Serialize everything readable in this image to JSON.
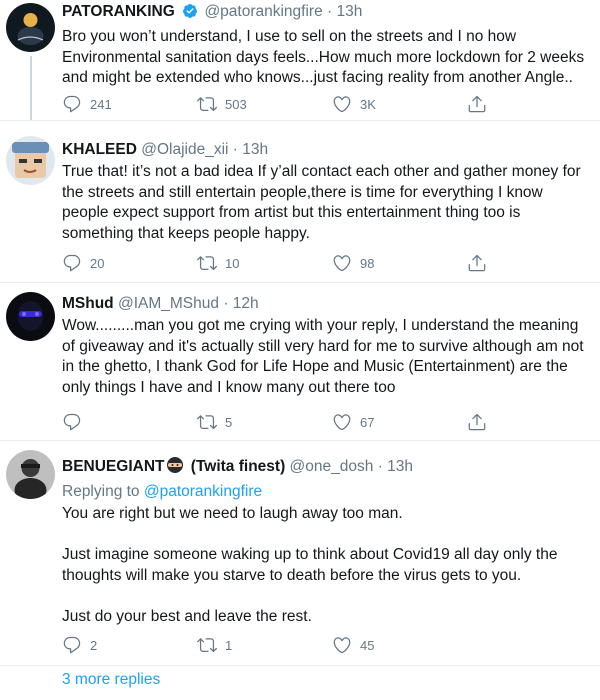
{
  "tweets": [
    {
      "name": "PATORANKING",
      "handle": "@patorankingfire",
      "time": "13h",
      "text": "Bro you won’t understand, I use to sell on the streets and I no how Environmental sanitation days feels...How much more lockdown for 2 weeks and might be extended who knows...just facing reality from another Angle..",
      "replies": "241",
      "retweets": "503",
      "likes": "3K",
      "verified": true
    },
    {
      "name": "KHALEED",
      "handle": "@Olajide_xii",
      "time": "13h",
      "text": "True that! it’s not a bad idea If y’all contact each other and gather money for the streets and still entertain people,there is time for everything I know people expect support from artist but this entertainment thing too is something that keeps people happy.",
      "replies": "20",
      "retweets": "10",
      "likes": "98"
    },
    {
      "name": "MShud",
      "handle": "@IAM_MShud",
      "time": "12h",
      "text": "Wow.........man you got me crying with your reply, I understand the meaning of giveaway and it's actually still very hard for me to survive although am not in the ghetto, I thank God for Life Hope and Music (Entertainment) are the only things I have and I know many out there too",
      "replies": "",
      "retweets": "5",
      "likes": "67"
    },
    {
      "name": "BENUEGIANT",
      "name_suffix": "(Twita finest)",
      "handle": "@one_dosh",
      "time": "13h",
      "replying_label": "Replying to",
      "replying_handle": "@patorankingfire",
      "text": "You are right but we need to laugh away too man.\n\nJust imagine someone waking up to think about Covid19 all day only the thoughts will make you starve to death before the virus gets to you.\n\nJust do your best and leave the rest.",
      "replies": "2",
      "retweets": "1",
      "likes": "45"
    }
  ],
  "separator": "·",
  "more_replies": "3 more replies",
  "colors": {
    "link": "#1da1f2",
    "secondary": "#657786",
    "verified": "#1da1f2"
  },
  "icons": [
    "reply-icon",
    "retweet-icon",
    "like-icon",
    "share-icon",
    "verified-badge-icon",
    "ninja-emoji-icon"
  ]
}
